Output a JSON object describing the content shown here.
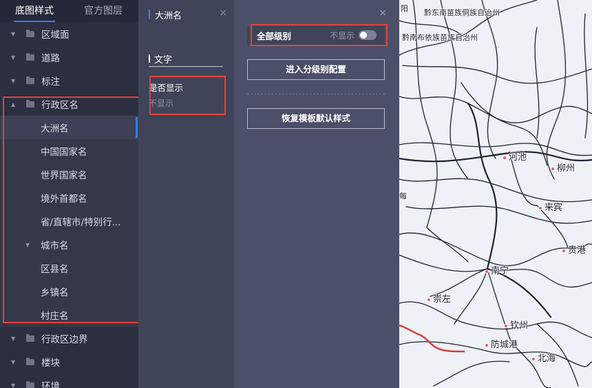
{
  "left_panel": {
    "tabs": [
      {
        "label": "底图样式"
      },
      {
        "label": "官方图层"
      }
    ],
    "tree": [
      {
        "label": "区域面",
        "arrow": "▼"
      },
      {
        "label": "道路",
        "arrow": "▼"
      },
      {
        "label": "标注",
        "arrow": "▼"
      },
      {
        "label": "行政区名",
        "arrow": "▲"
      },
      {
        "label": "大洲名"
      },
      {
        "label": "中国国家名"
      },
      {
        "label": "世界国家名"
      },
      {
        "label": "境外首都名"
      },
      {
        "label": "省/直辖市/特别行..."
      },
      {
        "label": "城市名",
        "arrow": "▼"
      },
      {
        "label": "区县名"
      },
      {
        "label": "乡镇名"
      },
      {
        "label": "村庄名"
      },
      {
        "label": "行政区边界",
        "arrow": "▼"
      },
      {
        "label": "楼块",
        "arrow": "▼"
      },
      {
        "label": "环境",
        "arrow": "▼"
      }
    ]
  },
  "middle_panel": {
    "title": "大洲名",
    "close_icon": "×",
    "section": "文字",
    "field_label": "是否显示",
    "field_value": "不显示"
  },
  "config_panel": {
    "close_icon": "×",
    "level_label": "全部级别",
    "level_state": "不显示",
    "enter_button": "进入分级别配置",
    "restore_button": "恢复模板默认样式"
  },
  "map": {
    "labels": {
      "top1": "黔东南苗族侗族自治州",
      "top2": "黔南布依族苗族自治州",
      "edge_top": "阳",
      "edge_mid": "每",
      "hechi": "河池",
      "liuzhou": "柳州",
      "laibin": "来宾",
      "guigang": "贵港",
      "nanning": "南宁",
      "chongzuo": "崇左",
      "qinzhou": "钦州",
      "fangchenggang": "防城港",
      "beihai": "北海"
    }
  },
  "colors": {
    "accent": "#3a7bff",
    "highlight_box": "#e8413a",
    "border_line": "#d83a3a"
  }
}
